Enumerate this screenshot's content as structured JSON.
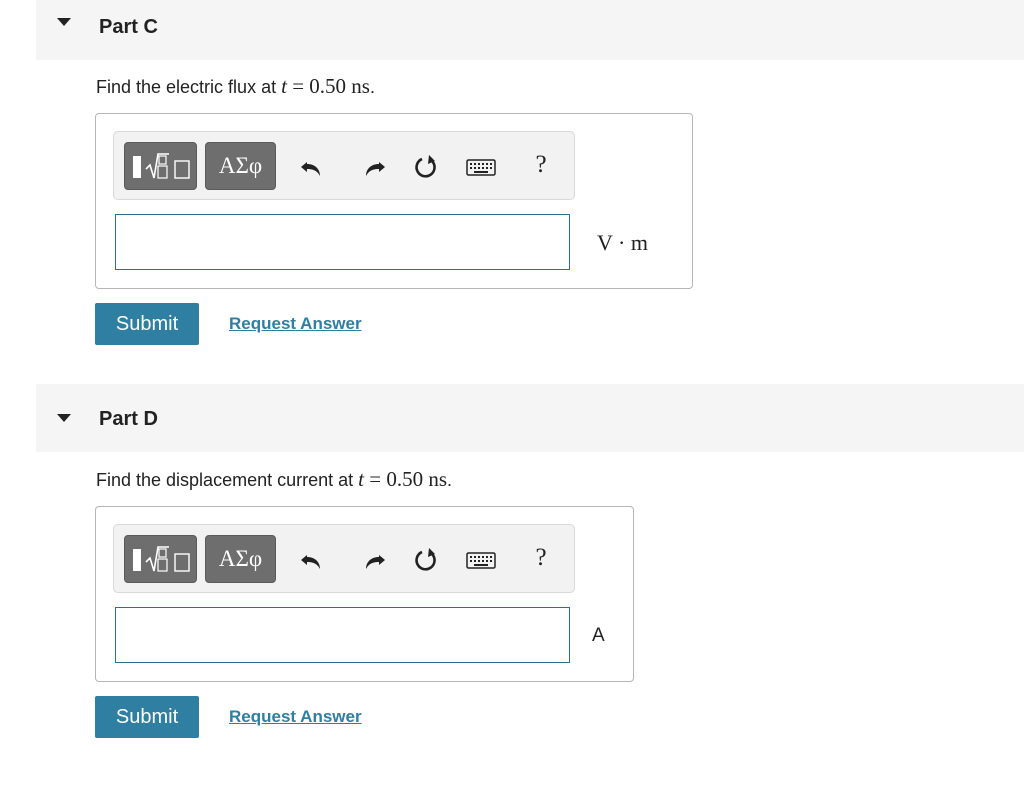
{
  "parts": [
    {
      "title": "Part C",
      "prompt_text": "Find the electric flux at ",
      "prompt_var": "t",
      "prompt_eq": " = ",
      "prompt_value": "0.50 ns",
      "prompt_end": ".",
      "answer_value": "",
      "unit": "V · m",
      "submit_label": "Submit",
      "request_label": "Request Answer"
    },
    {
      "title": "Part D",
      "prompt_text": "Find the displacement current at ",
      "prompt_var": "t",
      "prompt_eq": " = ",
      "prompt_value": "0.50 ns",
      "prompt_end": ".",
      "answer_value": "",
      "unit": "A",
      "submit_label": "Submit",
      "request_label": "Request Answer"
    }
  ],
  "toolbar": {
    "greek_label": "ΑΣφ",
    "help_label": "?",
    "icons": [
      "templates-icon",
      "greek-symbols-icon",
      "undo-icon",
      "redo-icon",
      "reset-icon",
      "keyboard-icon",
      "help-icon"
    ]
  },
  "colors": {
    "accent": "#2e7fa1",
    "header_bg": "#f5f5f5",
    "toolbar_button": "#6e6e6e",
    "input_border": "#2f6f8f"
  }
}
